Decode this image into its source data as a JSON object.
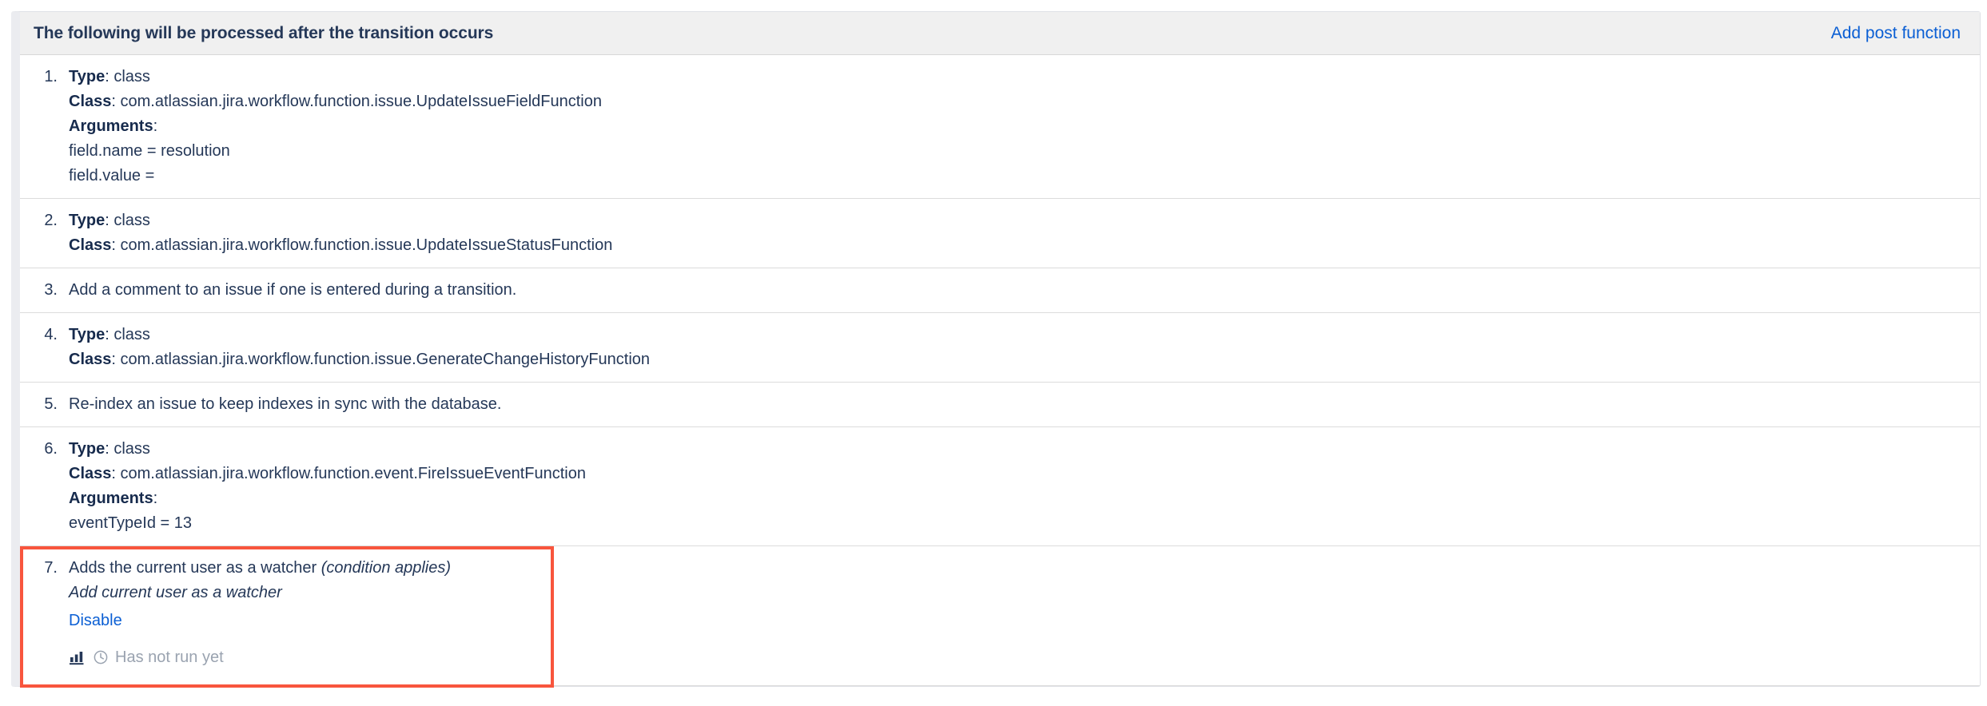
{
  "panel": {
    "header": {
      "title": "The following will be processed after the transition occurs",
      "action_label": "Add post function"
    },
    "labels": {
      "type": "Type",
      "class": "Class",
      "arguments": "Arguments"
    },
    "items": [
      {
        "index": "1.",
        "type_label": "Type",
        "type_value": ": class",
        "class_label": "Class",
        "class_value": ": com.atlassian.jira.workflow.function.issue.UpdateIssueFieldFunction",
        "arguments_label": "Arguments",
        "arguments_colon": ":",
        "arg1": "field.name = resolution",
        "arg2": "field.value ="
      },
      {
        "index": "2.",
        "type_label": "Type",
        "type_value": ": class",
        "class_label": "Class",
        "class_value": ": com.atlassian.jira.workflow.function.issue.UpdateIssueStatusFunction"
      },
      {
        "index": "3.",
        "description": "Add a comment to an issue if one is entered during a transition."
      },
      {
        "index": "4.",
        "type_label": "Type",
        "type_value": ": class",
        "class_label": "Class",
        "class_value": ": com.atlassian.jira.workflow.function.issue.GenerateChangeHistoryFunction"
      },
      {
        "index": "5.",
        "description": "Re-index an issue to keep indexes in sync with the database."
      },
      {
        "index": "6.",
        "type_label": "Type",
        "type_value": ": class",
        "class_label": "Class",
        "class_value": ": com.atlassian.jira.workflow.function.event.FireIssueEventFunction",
        "arguments_label": "Arguments",
        "arguments_colon": ":",
        "arg1": "eventTypeId = 13"
      },
      {
        "index": "7.",
        "description": "Adds the current user as a watcher ",
        "condition_note": "(condition applies)",
        "subtitle": "Add current user as a watcher",
        "action_link": "Disable",
        "status_text": "Has not run yet",
        "chart_icon": "bar-chart-icon",
        "clock_icon": "clock-icon"
      }
    ]
  },
  "colors": {
    "text": "#253858",
    "link": "#0b5fd4",
    "header_bg": "#f0f0f0",
    "highlight": "#f8553d",
    "muted": "#9aa3b0",
    "border": "#dcdcdc"
  }
}
